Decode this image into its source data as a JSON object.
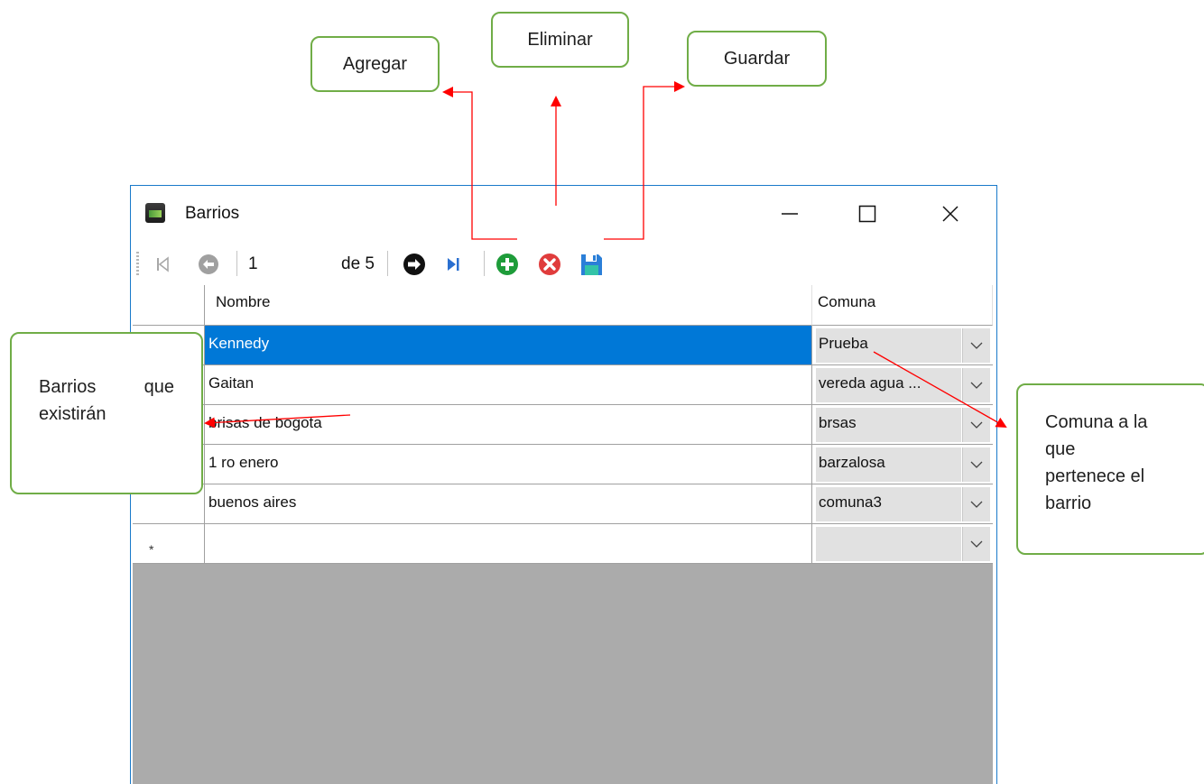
{
  "window": {
    "title": "Barrios"
  },
  "toolbar": {
    "position_value": "1",
    "count_label": "de 5"
  },
  "grid": {
    "columns": [
      "Nombre",
      "Comuna"
    ],
    "rows": [
      {
        "nombre": "Kennedy",
        "comuna": "Prueba",
        "selected": true
      },
      {
        "nombre": "Gaitan",
        "comuna": "vereda agua ...",
        "selected": false
      },
      {
        "nombre": "brisas de bogota",
        "comuna": "brsas",
        "selected": false
      },
      {
        "nombre": "1 ro enero",
        "comuna": "barzalosa",
        "selected": false
      },
      {
        "nombre": "buenos aires",
        "comuna": "comuna3",
        "selected": false
      }
    ],
    "new_row_marker": "*"
  },
  "annotations": {
    "agregar": "Agregar",
    "eliminar": "Eliminar",
    "guardar": "Guardar",
    "barrios": {
      "line1a": "Barrios",
      "line1b": "que",
      "line2": "existirán"
    },
    "comuna": {
      "line1": "Comuna a la",
      "line2": "que",
      "line3": "pertenece el",
      "line4": "barrio"
    }
  },
  "colors": {
    "selection": "#0078d7",
    "callout_border": "#70ad47",
    "arrow": "#ff0000",
    "grid_background": "#ababab"
  }
}
